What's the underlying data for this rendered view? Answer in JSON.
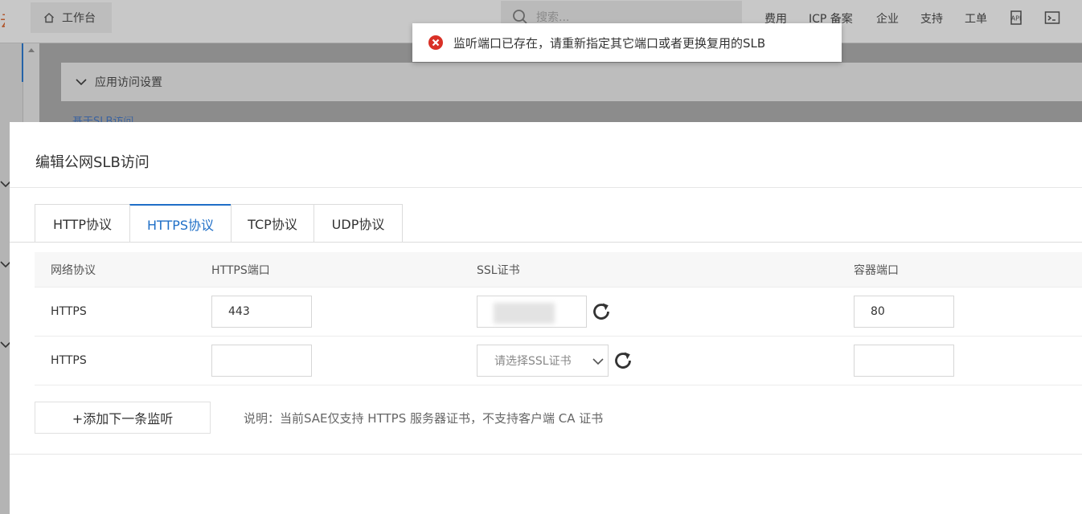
{
  "topbar": {
    "logo_char": "云",
    "workbench_label": "工作台",
    "search_placeholder": "搜索...",
    "nav": [
      "费用",
      "ICP 备案",
      "企业",
      "支持",
      "工单"
    ]
  },
  "background": {
    "section_label": "应用访问设置",
    "link_label": "基于SLB访问"
  },
  "toast": {
    "message": "监听端口已存在，请重新指定其它端口或者更换复用的SLB",
    "icon": "error-circle-icon",
    "color": "#d93026"
  },
  "dialog": {
    "title": "编辑公网SLB访问",
    "tabs": [
      {
        "label": "HTTP协议",
        "active": false
      },
      {
        "label": "HTTPS协议",
        "active": true
      },
      {
        "label": "TCP协议",
        "active": false
      },
      {
        "label": "UDP协议",
        "active": false
      }
    ],
    "columns": [
      "网络协议",
      "HTTPS端口",
      "SSL证书",
      "容器端口"
    ],
    "rows": [
      {
        "protocol": "HTTPS",
        "https_port": "443",
        "ssl_cert": "",
        "container_port": "80"
      },
      {
        "protocol": "HTTPS",
        "https_port": "",
        "ssl_cert_placeholder": "请选择SSL证书",
        "container_port": ""
      }
    ],
    "add_button": "+添加下一条监听",
    "note": "说明：当前SAE仅支持 HTTPS 服务器证书，不支持客户端 CA 证书"
  },
  "colors": {
    "accent": "#1f6fc7",
    "error": "#d93026"
  }
}
